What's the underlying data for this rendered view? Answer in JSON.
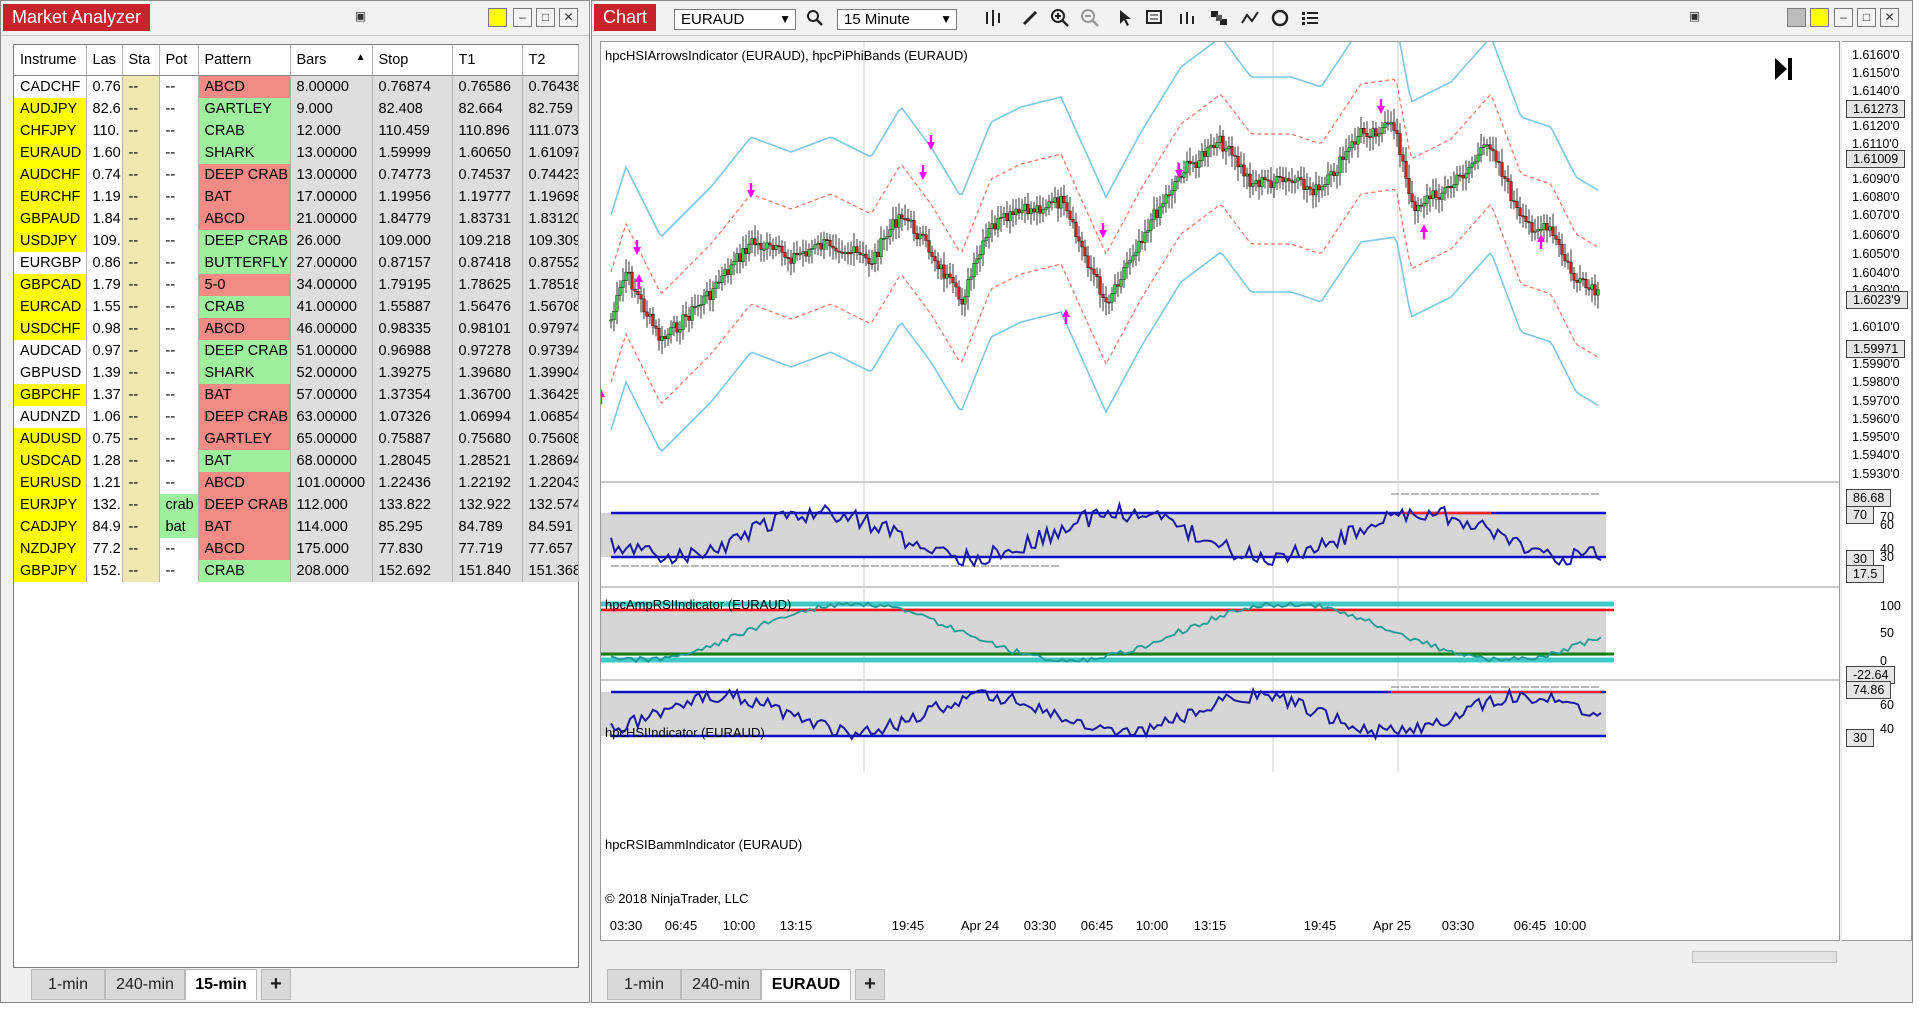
{
  "market_analyzer": {
    "title": "Market Analyzer",
    "columns": [
      "Instrume",
      "Las",
      "Sta",
      "Pot",
      "Pattern",
      "Bars",
      "Stop",
      "T1",
      "T2"
    ],
    "rows": [
      {
        "inst": "CADCHF",
        "hl": false,
        "last": "0.76",
        "state": "--",
        "pot": "--",
        "pattern": "ABCD",
        "pc": "red",
        "bars": "8.00000",
        "stop": "0.76874",
        "t1": "0.76586",
        "t2": "0.76438"
      },
      {
        "inst": "AUDJPY",
        "hl": true,
        "last": "82.6",
        "state": "--",
        "pot": "--",
        "pattern": "GARTLEY",
        "pc": "green",
        "bars": "9.000",
        "stop": "82.408",
        "t1": "82.664",
        "t2": "82.759"
      },
      {
        "inst": "CHFJPY",
        "hl": true,
        "last": "110.",
        "state": "--",
        "pot": "--",
        "pattern": "CRAB",
        "pc": "green",
        "bars": "12.000",
        "stop": "110.459",
        "t1": "110.896",
        "t2": "111.073"
      },
      {
        "inst": "EURAUD",
        "hl": true,
        "last": "1.60",
        "state": "--",
        "pot": "--",
        "pattern": "SHARK",
        "pc": "green",
        "bars": "13.00000",
        "stop": "1.59999",
        "t1": "1.60650",
        "t2": "1.61097"
      },
      {
        "inst": "AUDCHF",
        "hl": true,
        "last": "0.74",
        "state": "--",
        "pot": "--",
        "pattern": "DEEP CRAB",
        "pc": "red",
        "bars": "13.00000",
        "stop": "0.74773",
        "t1": "0.74537",
        "t2": "0.74423"
      },
      {
        "inst": "EURCHF",
        "hl": true,
        "last": "1.19",
        "state": "--",
        "pot": "--",
        "pattern": "BAT",
        "pc": "red",
        "bars": "17.00000",
        "stop": "1.19956",
        "t1": "1.19777",
        "t2": "1.19698"
      },
      {
        "inst": "GBPAUD",
        "hl": true,
        "last": "1.84",
        "state": "--",
        "pot": "--",
        "pattern": "ABCD",
        "pc": "red",
        "bars": "21.00000",
        "stop": "1.84779",
        "t1": "1.83731",
        "t2": "1.83120"
      },
      {
        "inst": "USDJPY",
        "hl": true,
        "last": "109.",
        "state": "--",
        "pot": "--",
        "pattern": "DEEP CRAB",
        "pc": "green",
        "bars": "26.000",
        "stop": "109.000",
        "t1": "109.218",
        "t2": "109.309"
      },
      {
        "inst": "EURGBP",
        "hl": false,
        "last": "0.86",
        "state": "--",
        "pot": "--",
        "pattern": "BUTTERFLY",
        "pc": "green",
        "bars": "27.00000",
        "stop": "0.87157",
        "t1": "0.87418",
        "t2": "0.87552"
      },
      {
        "inst": "GBPCAD",
        "hl": true,
        "last": "1.79",
        "state": "--",
        "pot": "--",
        "pattern": "5-0",
        "pc": "red",
        "bars": "34.00000",
        "stop": "1.79195",
        "t1": "1.78625",
        "t2": "1.78518"
      },
      {
        "inst": "EURCAD",
        "hl": true,
        "last": "1.55",
        "state": "--",
        "pot": "--",
        "pattern": "CRAB",
        "pc": "green",
        "bars": "41.00000",
        "stop": "1.55887",
        "t1": "1.56476",
        "t2": "1.56708"
      },
      {
        "inst": "USDCHF",
        "hl": true,
        "last": "0.98",
        "state": "--",
        "pot": "--",
        "pattern": "ABCD",
        "pc": "red",
        "bars": "46.00000",
        "stop": "0.98335",
        "t1": "0.98101",
        "t2": "0.97974"
      },
      {
        "inst": "AUDCAD",
        "hl": false,
        "last": "0.97",
        "state": "--",
        "pot": "--",
        "pattern": "DEEP CRAB",
        "pc": "green",
        "bars": "51.00000",
        "stop": "0.96988",
        "t1": "0.97278",
        "t2": "0.97394"
      },
      {
        "inst": "GBPUSD",
        "hl": false,
        "last": "1.39",
        "state": "--",
        "pot": "--",
        "pattern": "SHARK",
        "pc": "green",
        "bars": "52.00000",
        "stop": "1.39275",
        "t1": "1.39680",
        "t2": "1.39904"
      },
      {
        "inst": "GBPCHF",
        "hl": true,
        "last": "1.37",
        "state": "--",
        "pot": "--",
        "pattern": "BAT",
        "pc": "red",
        "bars": "57.00000",
        "stop": "1.37354",
        "t1": "1.36700",
        "t2": "1.36425"
      },
      {
        "inst": "AUDNZD",
        "hl": false,
        "last": "1.06",
        "state": "--",
        "pot": "--",
        "pattern": "DEEP CRAB",
        "pc": "red",
        "bars": "63.00000",
        "stop": "1.07326",
        "t1": "1.06994",
        "t2": "1.06854"
      },
      {
        "inst": "AUDUSD",
        "hl": true,
        "last": "0.75",
        "state": "--",
        "pot": "--",
        "pattern": "GARTLEY",
        "pc": "red",
        "bars": "65.00000",
        "stop": "0.75887",
        "t1": "0.75680",
        "t2": "0.75608"
      },
      {
        "inst": "USDCAD",
        "hl": true,
        "last": "1.28",
        "state": "--",
        "pot": "--",
        "pattern": "BAT",
        "pc": "green",
        "bars": "68.00000",
        "stop": "1.28045",
        "t1": "1.28521",
        "t2": "1.28694"
      },
      {
        "inst": "EURUSD",
        "hl": true,
        "last": "1.21",
        "state": "--",
        "pot": "--",
        "pattern": "ABCD",
        "pc": "red",
        "bars": "101.00000",
        "stop": "1.22436",
        "t1": "1.22192",
        "t2": "1.22043"
      },
      {
        "inst": "EURJPY",
        "hl": true,
        "last": "132.",
        "state": "--",
        "pot": "crab",
        "potc": "green",
        "pattern": "DEEP CRAB",
        "pc": "red",
        "bars": "112.000",
        "stop": "133.822",
        "t1": "132.922",
        "t2": "132.574"
      },
      {
        "inst": "CADJPY",
        "hl": true,
        "last": "84.9",
        "state": "--",
        "pot": "bat",
        "potc": "green",
        "pattern": "BAT",
        "pc": "red",
        "bars": "114.000",
        "stop": "85.295",
        "t1": "84.789",
        "t2": "84.591"
      },
      {
        "inst": "NZDJPY",
        "hl": true,
        "last": "77.2",
        "state": "--",
        "pot": "--",
        "pattern": "ABCD",
        "pc": "red",
        "bars": "175.000",
        "stop": "77.830",
        "t1": "77.719",
        "t2": "77.657"
      },
      {
        "inst": "GBPJPY",
        "hl": true,
        "last": "152.",
        "state": "--",
        "pot": "--",
        "pattern": "CRAB",
        "pc": "green",
        "bars": "208.000",
        "stop": "152.692",
        "t1": "151.840",
        "t2": "151.368"
      }
    ],
    "tabs": [
      "1-min",
      "240-min",
      "15-min"
    ],
    "active_tab": "15-min",
    "add_tab": "+"
  },
  "chart": {
    "title": "Chart",
    "instrument": "EURAUD",
    "interval": "15 Minute",
    "tabs": [
      "1-min",
      "240-min",
      "EURAUD"
    ],
    "active_tab": "EURAUD",
    "add_tab": "+",
    "copyright": "© 2018 NinjaTrader, LLC",
    "price_panel": {
      "title": "hpcHSIArrowsIndicator (EURAUD), hpcPiPhiBands (EURAUD)",
      "y_ticks": [
        "1.6160'0",
        "1.6150'0",
        "1.6140'0",
        "1.6120'0",
        "1.6110'0",
        "1.6090'0",
        "1.6080'0",
        "1.6070'0",
        "1.6060'0",
        "1.6050'0",
        "1.6040'0",
        "1.6030'0",
        "1.6010'0",
        "1.5990'0",
        "1.5980'0",
        "1.5970'0",
        "1.5960'0",
        "1.5950'0",
        "1.5940'0",
        "1.5930'0"
      ],
      "flags": [
        "1.61273",
        "1.61009",
        "1.6023'9",
        "1.59971"
      ]
    },
    "rsi_panel": {
      "title": "hpcAmpRSIIndicator (EURAUD)",
      "ticks": [
        "70",
        "60",
        "40",
        "30"
      ],
      "flags": [
        "86.68",
        "70",
        "30",
        "17.5"
      ]
    },
    "hsi_panel": {
      "title": "hpcHSIIndicator (EURAUD)",
      "ticks": [
        "100",
        "50",
        "0"
      ],
      "flags": [
        "-22.64"
      ]
    },
    "bamm_panel": {
      "title": "hpcRSIBammIndicator (EURAUD)",
      "ticks": [
        "60",
        "40"
      ],
      "flags": [
        "74.86",
        "30"
      ]
    },
    "x_labels": [
      "03:30",
      "06:45",
      "10:00",
      "13:15",
      "19:45",
      "Apr 24",
      "03:30",
      "06:45",
      "10:00",
      "13:15",
      "19:45",
      "Apr 25",
      "03:30",
      "06:45",
      "10:00"
    ]
  },
  "colors": {
    "accent": "#c8232a",
    "band_outer": "#7ec8e3",
    "band_inner": "#f07060",
    "rsi_line": "#1a1aa0",
    "hsi_line": "#1e9a96",
    "up": "#2ecc40",
    "down": "#d0201a"
  }
}
